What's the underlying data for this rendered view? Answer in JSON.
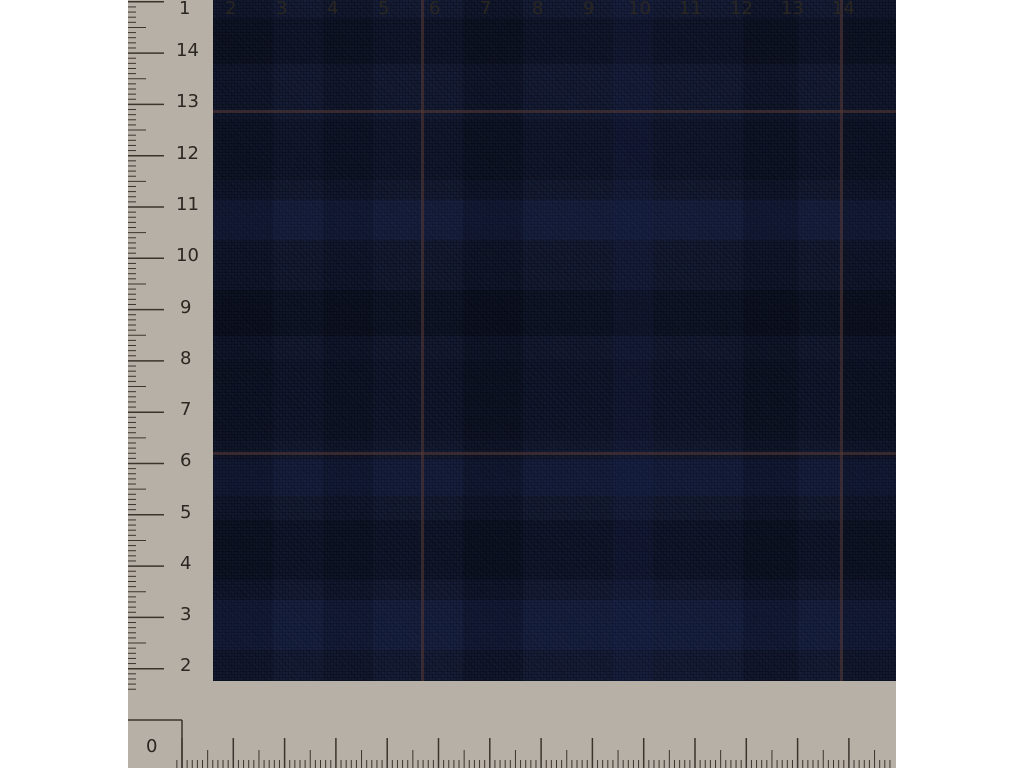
{
  "ruler": {
    "origin_label": "0",
    "left_labels": [
      "2",
      "3",
      "4",
      "5",
      "6",
      "7",
      "8",
      "9",
      "10",
      "11",
      "12",
      "13",
      "14"
    ],
    "bottom_labels": [
      "1",
      "2",
      "3",
      "4",
      "5",
      "6",
      "7",
      "8",
      "9",
      "10",
      "11",
      "12",
      "13",
      "14"
    ]
  },
  "colors": {
    "ruler_bg": "#b7b0a6",
    "fabric_base": "#141b33",
    "fabric_dark_band": "#0e1428",
    "fabric_blue_band": "#1b2550",
    "overcheck_stripe": "#5a3a34",
    "text": "#2a2622"
  },
  "subject": "navy blue glen check fabric with rust overcheck on measuring ruler"
}
